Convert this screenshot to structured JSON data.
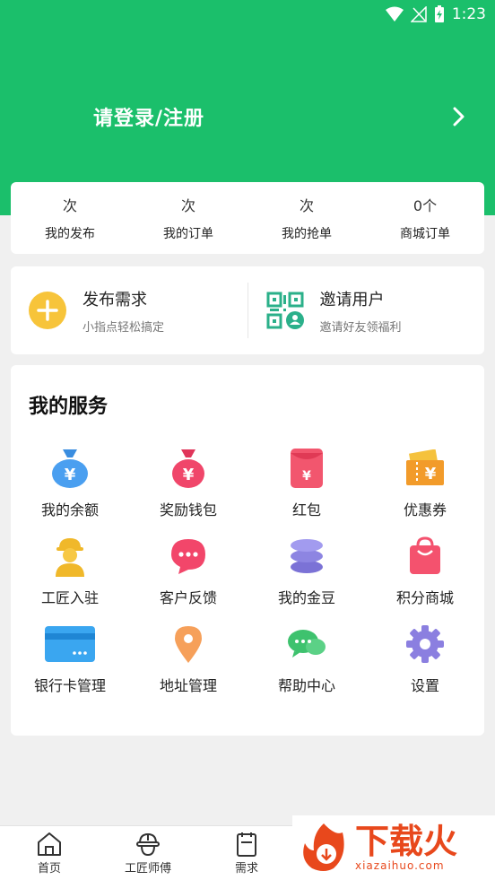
{
  "status_bar": {
    "time": "1:23"
  },
  "header": {
    "login_text": "请登录/注册"
  },
  "stats": [
    {
      "value": "次",
      "label": "我的发布"
    },
    {
      "value": "次",
      "label": "我的订单"
    },
    {
      "value": "次",
      "label": "我的抢单"
    },
    {
      "value": "0个",
      "label": "商城订单"
    }
  ],
  "actions": {
    "publish": {
      "title": "发布需求",
      "subtitle": "小指点轻松搞定"
    },
    "invite": {
      "title": "邀请用户",
      "subtitle": "邀请好友领福利"
    }
  },
  "services": {
    "title": "我的服务",
    "items": [
      {
        "label": "我的余额",
        "icon": "money-bag-icon"
      },
      {
        "label": "奖励钱包",
        "icon": "reward-bag-icon"
      },
      {
        "label": "红包",
        "icon": "red-envelope-icon"
      },
      {
        "label": "优惠券",
        "icon": "coupon-icon"
      },
      {
        "label": "工匠入驻",
        "icon": "worker-icon"
      },
      {
        "label": "客户反馈",
        "icon": "chat-bubble-icon"
      },
      {
        "label": "我的金豆",
        "icon": "coin-stack-icon"
      },
      {
        "label": "积分商城",
        "icon": "shopping-bag-icon"
      },
      {
        "label": "银行卡管理",
        "icon": "bank-card-icon"
      },
      {
        "label": "地址管理",
        "icon": "location-pin-icon"
      },
      {
        "label": "帮助中心",
        "icon": "help-chat-icon"
      },
      {
        "label": "设置",
        "icon": "gear-icon"
      }
    ]
  },
  "tabbar": [
    {
      "label": "首页",
      "icon": "home-icon"
    },
    {
      "label": "工匠师傅",
      "icon": "helmet-icon"
    },
    {
      "label": "需求",
      "icon": "clipboard-icon"
    }
  ],
  "watermark": {
    "brand": "下载火",
    "url": "xiazaihuo.com"
  },
  "colors": {
    "primary": "#1bbf6b",
    "background": "#f0f0f0",
    "watermark": "#e8481c"
  }
}
